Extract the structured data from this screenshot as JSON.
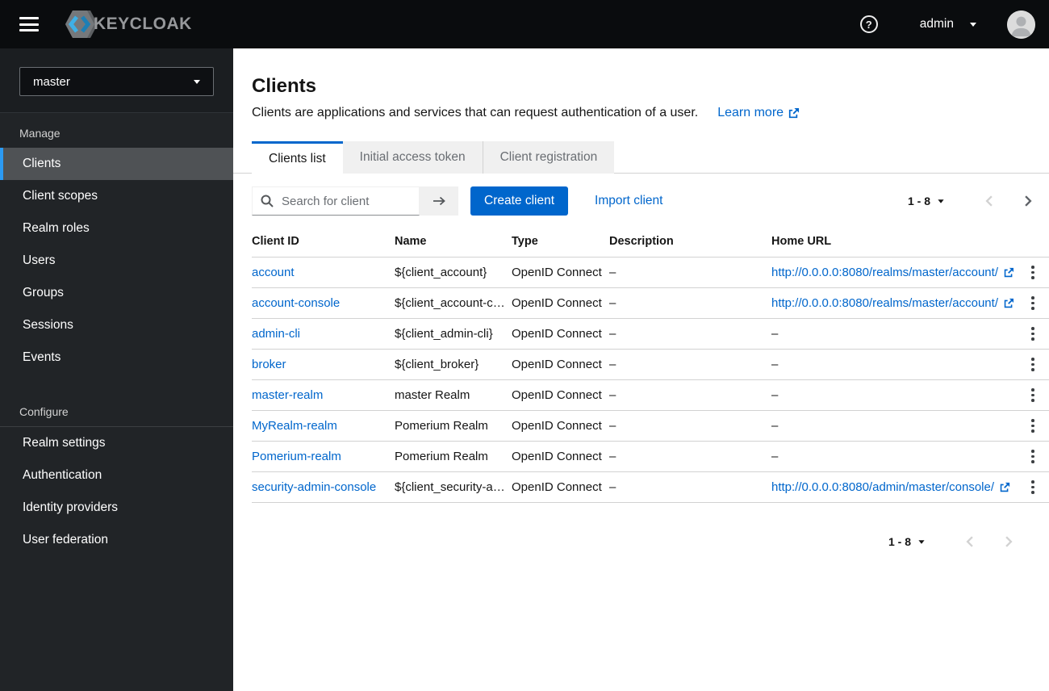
{
  "masthead": {
    "brand": "KEYCLOAK",
    "user": "admin"
  },
  "sidebar": {
    "realm_selector": "master",
    "sections": [
      {
        "label": "Manage",
        "divider": false,
        "items": [
          {
            "label": "Clients",
            "selected": true
          },
          {
            "label": "Client scopes",
            "selected": false
          },
          {
            "label": "Realm roles",
            "selected": false
          },
          {
            "label": "Users",
            "selected": false
          },
          {
            "label": "Groups",
            "selected": false
          },
          {
            "label": "Sessions",
            "selected": false
          },
          {
            "label": "Events",
            "selected": false
          }
        ]
      },
      {
        "label": "Configure",
        "divider": true,
        "items": [
          {
            "label": "Realm settings",
            "selected": false
          },
          {
            "label": "Authentication",
            "selected": false
          },
          {
            "label": "Identity providers",
            "selected": false
          },
          {
            "label": "User federation",
            "selected": false
          }
        ]
      }
    ]
  },
  "page": {
    "title": "Clients",
    "subtitle": "Clients are applications and services that can request authentication of a user.",
    "learn_more": "Learn more",
    "tabs": [
      {
        "label": "Clients list",
        "active": true
      },
      {
        "label": "Initial access token",
        "active": false
      },
      {
        "label": "Client registration",
        "active": false
      }
    ]
  },
  "toolbar": {
    "search_placeholder": "Search for client",
    "create_button": "Create client",
    "import_link": "Import client",
    "pagination": "1 - 8"
  },
  "table": {
    "columns": [
      "Client ID",
      "Name",
      "Type",
      "Description",
      "Home URL"
    ],
    "empty_cell": "–",
    "rows": [
      {
        "client_id": "account",
        "name": "${client_account}",
        "type": "OpenID Connect",
        "description": "–",
        "home_url": "http://0.0.0.0:8080/realms/master/account/"
      },
      {
        "client_id": "account-console",
        "name": "${client_account-c…",
        "type": "OpenID Connect",
        "description": "–",
        "home_url": "http://0.0.0.0:8080/realms/master/account/"
      },
      {
        "client_id": "admin-cli",
        "name": "${client_admin-cli}",
        "type": "OpenID Connect",
        "description": "–",
        "home_url": null
      },
      {
        "client_id": "broker",
        "name": "${client_broker}",
        "type": "OpenID Connect",
        "description": "–",
        "home_url": null
      },
      {
        "client_id": "master-realm",
        "name": "master Realm",
        "type": "OpenID Connect",
        "description": "–",
        "home_url": null
      },
      {
        "client_id": "MyRealm-realm",
        "name": "Pomerium Realm",
        "type": "OpenID Connect",
        "description": "–",
        "home_url": null
      },
      {
        "client_id": "Pomerium-realm",
        "name": "Pomerium Realm",
        "type": "OpenID Connect",
        "description": "–",
        "home_url": null
      },
      {
        "client_id": "security-admin-console",
        "name": "${client_security-a…",
        "type": "OpenID Connect",
        "description": "–",
        "home_url": "http://0.0.0.0:8080/admin/master/console/"
      }
    ]
  },
  "footer": {
    "pagination": "1 - 8"
  },
  "colors": {
    "accent_blue": "#0066cc",
    "nav_selected_bar": "#2b9af3",
    "masthead_bg": "#0a0c0e",
    "sidebar_bg": "#212427",
    "border_gray": "#d2d2d2"
  }
}
